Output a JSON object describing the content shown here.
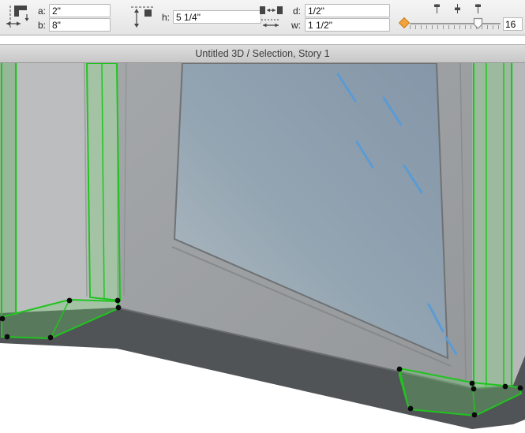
{
  "titlebar": {
    "title": "Untitled 3D / Selection, Story 1"
  },
  "toolbar": {
    "fields": {
      "a": {
        "label": "a:",
        "value": "2\""
      },
      "b": {
        "label": "b:",
        "value": "8\""
      },
      "h": {
        "label": "h:",
        "value": "5 1/4\""
      },
      "d": {
        "label": "d:",
        "value": "1/2\""
      },
      "w": {
        "label": "w:",
        "value": "1 1/2\""
      }
    },
    "slider": {
      "value": "16"
    },
    "icons": {
      "group1": "door-reveal-dimensions-icon",
      "group2": "door-header-height-icon",
      "group3": "door-jamb-thickness-icon",
      "diamond": "marker-diamond-icon",
      "minis": [
        "mini-slider-icon-1",
        "mini-slider-icon-2",
        "mini-slider-icon-3"
      ]
    }
  },
  "colors": {
    "selection-green": "#1fc41f",
    "selection-green-fill": "rgba(110,210,110,0.30)",
    "glass-top": "#8496a8",
    "glass-mid": "#93a5b2",
    "glass-bottom": "#b2bcc2",
    "wall-gray": "#bcbdbe",
    "wall-dark": "#aaacad",
    "door-gray": "#9b9ea0",
    "shadow-gray": "#515456",
    "glint-blue": "#5b9bd5",
    "accent-orange": "#f2a33c",
    "node-black": "#0a0a0a"
  }
}
